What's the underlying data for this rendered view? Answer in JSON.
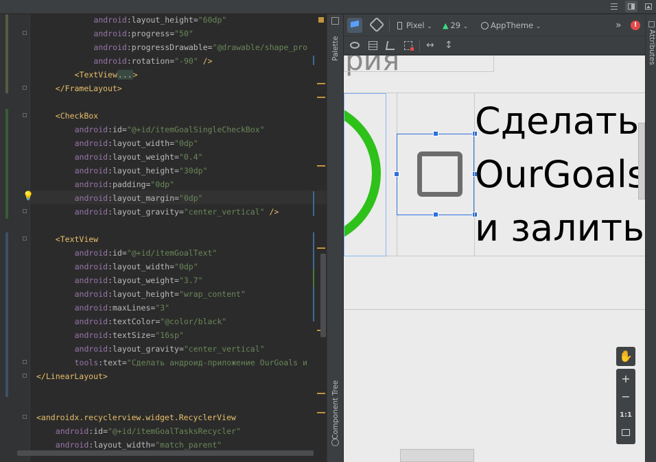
{
  "code_lines": [
    {
      "indent": "            ",
      "ns": "android",
      "attr": "layout_height",
      "val": "\"60dp\"",
      "tail": ""
    },
    {
      "indent": "            ",
      "ns": "android",
      "attr": "progress",
      "val": "\"50\"",
      "tail": ""
    },
    {
      "indent": "            ",
      "ns": "android",
      "attr": "progressDrawable",
      "val": "\"@drawable/shape_pro",
      "tail": ""
    },
    {
      "indent": "            ",
      "ns": "android",
      "attr": "rotation",
      "val": "\"-90\"",
      "tail": " />"
    },
    {
      "indent": "        ",
      "tag": "<TextView",
      "fold": "...",
      "tagend": ">"
    },
    {
      "indent": "    ",
      "tag": "</FrameLayout>"
    },
    {
      "indent": ""
    },
    {
      "indent": "    ",
      "tag": "<CheckBox"
    },
    {
      "indent": "        ",
      "ns": "android",
      "attr": "id",
      "val": "\"@+id/itemGoalSingleCheckBox\"",
      "tail": ""
    },
    {
      "indent": "        ",
      "ns": "android",
      "attr": "layout_width",
      "val": "\"0dp\"",
      "tail": ""
    },
    {
      "indent": "        ",
      "ns": "android",
      "attr": "layout_weight",
      "val": "\"0.4\"",
      "tail": ""
    },
    {
      "indent": "        ",
      "ns": "android",
      "attr": "layout_height",
      "val": "\"30dp\"",
      "tail": ""
    },
    {
      "indent": "        ",
      "ns": "android",
      "attr": "padding",
      "val": "\"0dp\"",
      "tail": ""
    },
    {
      "indent": "        ",
      "ns": "android",
      "attr": "layout_margin",
      "val": "\"0dp\"",
      "tail": ""
    },
    {
      "indent": "        ",
      "ns": "android",
      "attr": "layout_gravity",
      "val": "\"center_vertical\"",
      "tail": " />"
    },
    {
      "indent": ""
    },
    {
      "indent": "    ",
      "tag": "<TextView"
    },
    {
      "indent": "        ",
      "ns": "android",
      "attr": "id",
      "val": "\"@+id/itemGoalText\"",
      "tail": ""
    },
    {
      "indent": "        ",
      "ns": "android",
      "attr": "layout_width",
      "val": "\"0dp\"",
      "tail": ""
    },
    {
      "indent": "        ",
      "ns": "android",
      "attr": "layout_weight",
      "val": "\"3.7\"",
      "tail": ""
    },
    {
      "indent": "        ",
      "ns": "android",
      "attr": "layout_height",
      "val": "\"wrap_content\"",
      "tail": ""
    },
    {
      "indent": "        ",
      "ns": "android",
      "attr": "maxLines",
      "val": "\"3\"",
      "tail": ""
    },
    {
      "indent": "        ",
      "ns": "android",
      "attr": "textColor",
      "val": "\"@color/black\"",
      "tail": ""
    },
    {
      "indent": "        ",
      "ns": "android",
      "attr": "textSize",
      "val": "\"16sp\"",
      "tail": ""
    },
    {
      "indent": "        ",
      "ns": "android",
      "attr": "layout_gravity",
      "val": "\"center_vertical\"",
      "tail": ""
    },
    {
      "indent": "        ",
      "ns": "tools",
      "attr": "text",
      "val": "\"Сделать андроид-приложение OurGoals и",
      "tail": ""
    },
    {
      "indent": "",
      "tag": "</LinearLayout>"
    },
    {
      "indent": ""
    },
    {
      "indent": ""
    },
    {
      "indent": "",
      "tag": "<androidx.recyclerview.widget.RecyclerView"
    },
    {
      "indent": "    ",
      "ns": "android",
      "attr": "id",
      "val": "\"@+id/itemGoalTasksRecycler\"",
      "tail": ""
    },
    {
      "indent": "    ",
      "ns": "android",
      "attr": "layout_width",
      "val": "\"match_parent\"",
      "tail": ""
    }
  ],
  "design_toolbar": {
    "device": "Pixel",
    "api": "29",
    "theme": "AppTheme",
    "more": "»"
  },
  "rails": {
    "palette": "Palette",
    "component_tree": "Component Tree",
    "attributes": "Attributes"
  },
  "preview": {
    "header_ghost": "рия",
    "text_lines": [
      "Сделать",
      "OurGoals",
      "и залить"
    ]
  },
  "zoom": {
    "zoom_in": "+",
    "zoom_out": "−",
    "actual_size": "1:1"
  },
  "colors": {
    "progress_ring": "#2ec11a",
    "selection": "#2d6fdc",
    "error_badge": "#e04a4a"
  }
}
